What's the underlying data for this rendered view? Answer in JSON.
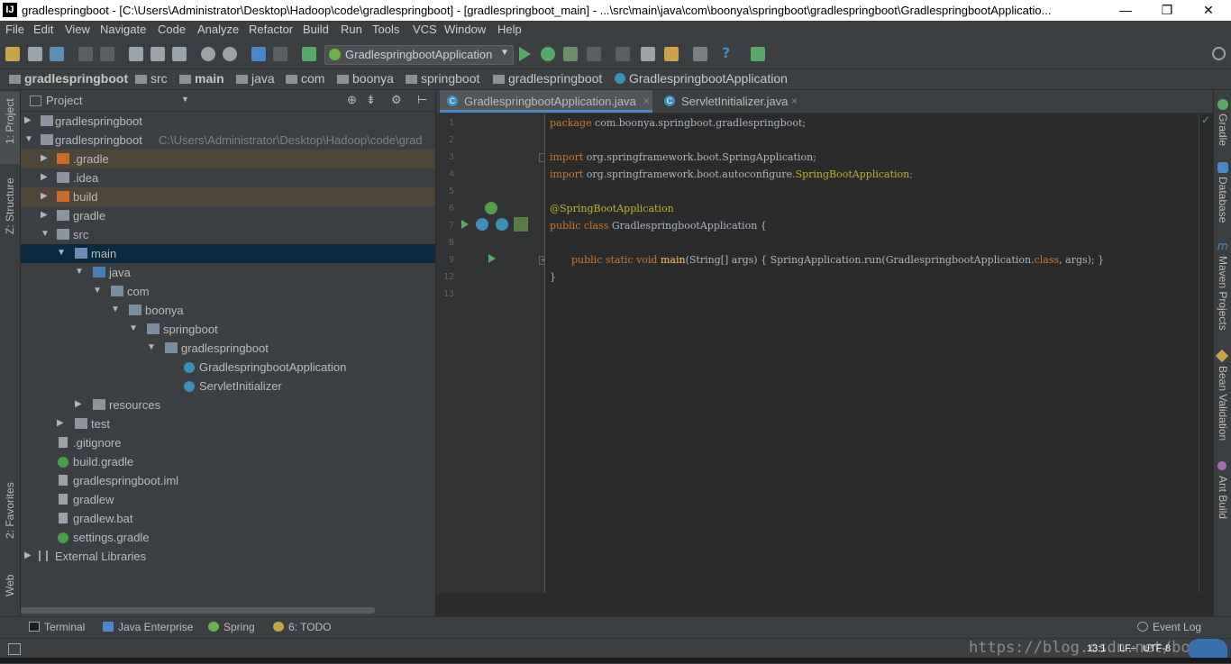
{
  "window": {
    "title": "gradlespringboot - [C:\\Users\\Administrator\\Desktop\\Hadoop\\code\\gradlespringboot] - [gradlespringboot_main] - ...\\src\\main\\java\\com\\boonya\\springboot\\gradlespringboot\\GradlespringbootApplicatio...",
    "minimize": "—",
    "maximize": "❐",
    "close": "✕"
  },
  "menu": [
    "File",
    "Edit",
    "View",
    "Navigate",
    "Code",
    "Analyze",
    "Refactor",
    "Build",
    "Run",
    "Tools",
    "VCS",
    "Window",
    "Help"
  ],
  "toolbar": {
    "run_config": "GradlespringbootApplication",
    "help": "?"
  },
  "breadcrumb": [
    "gradlespringboot",
    "src",
    "main",
    "java",
    "com",
    "boonya",
    "springboot",
    "gradlespringboot",
    "GradlespringbootApplication"
  ],
  "left_stripe": {
    "project": "1: Project",
    "structure": "Z: Structure",
    "favorites": "2: Favorites",
    "web": "Web"
  },
  "project_panel": {
    "title": "Project",
    "tree": [
      {
        "label": "gradlespringboot",
        "arrow": "▶",
        "icon": "module"
      },
      {
        "label": "gradlespringboot",
        "arrow": "▼",
        "icon": "module",
        "path": "C:\\Users\\Administrator\\Desktop\\Hadoop\\code\\grad"
      },
      {
        "label": ".gradle",
        "arrow": "▶",
        "icon": "orange-folder"
      },
      {
        "label": ".idea",
        "arrow": "▶",
        "icon": "folder"
      },
      {
        "label": "build",
        "arrow": "▶",
        "icon": "orange-folder"
      },
      {
        "label": "gradle",
        "arrow": "▶",
        "icon": "folder"
      },
      {
        "label": "src",
        "arrow": "▼",
        "icon": "folder"
      },
      {
        "label": "main",
        "arrow": "▼",
        "icon": "folder"
      },
      {
        "label": "java",
        "arrow": "▼",
        "icon": "folder"
      },
      {
        "label": "com",
        "arrow": "▼",
        "icon": "package"
      },
      {
        "label": "boonya",
        "arrow": "▼",
        "icon": "package"
      },
      {
        "label": "springboot",
        "arrow": "▼",
        "icon": "package"
      },
      {
        "label": "gradlespringboot",
        "arrow": "▼",
        "icon": "package"
      },
      {
        "label": "GradlespringbootApplication",
        "arrow": "",
        "icon": "class"
      },
      {
        "label": "ServletInitializer",
        "arrow": "",
        "icon": "class"
      },
      {
        "label": "resources",
        "arrow": "▶",
        "icon": "folder"
      },
      {
        "label": "test",
        "arrow": "▶",
        "icon": "folder"
      },
      {
        "label": ".gitignore",
        "arrow": "",
        "icon": "file"
      },
      {
        "label": "build.gradle",
        "arrow": "",
        "icon": "gradle"
      },
      {
        "label": "gradlespringboot.iml",
        "arrow": "",
        "icon": "file"
      },
      {
        "label": "gradlew",
        "arrow": "",
        "icon": "file"
      },
      {
        "label": "gradlew.bat",
        "arrow": "",
        "icon": "file"
      },
      {
        "label": "settings.gradle",
        "arrow": "",
        "icon": "gradle"
      },
      {
        "label": "External Libraries",
        "arrow": "▶",
        "icon": "library"
      }
    ]
  },
  "editor": {
    "tabs": [
      {
        "label": "GradlespringbootApplication.java",
        "close": "×"
      },
      {
        "label": "ServletInitializer.java",
        "close": "×"
      }
    ],
    "line_numbers": [
      "1",
      "2",
      "3",
      "4",
      "5",
      "6",
      "7",
      "8",
      "9",
      "12",
      "13"
    ],
    "code": {
      "l1_kw": "package",
      "l1_rest": " com.boonya.springboot.gradlespringboot;",
      "l3_kw": "import",
      "l3_rest": " org.springframework.boot.SpringApplication;",
      "l4_kw": "import",
      "l4_rest": " org.springframework.boot.autoconfigure.",
      "l4_ann": "SpringBootApplication",
      "l4_end": ";",
      "l6_ann": "@SpringBootApplication",
      "l7_kw": "public class",
      "l7_rest": " GradlespringbootApplication {",
      "l9_kw": "public static void",
      "l9_fn": " main",
      "l9_rest": "(String[] args) { SpringApplication.run(GradlespringbootApplication.",
      "l9_kw2": "class",
      "l9_end": ", args); }",
      "l12": "}"
    }
  },
  "right_stripe": [
    "Gradle",
    "Database",
    "Maven Projects",
    "Bean Validation",
    "Ant Build"
  ],
  "bottom_tools": [
    "Terminal",
    "Java Enterprise",
    "Spring",
    "6: TODO"
  ],
  "event_log": "Event Log",
  "status": {
    "position": "13:1",
    "line_sep": "LF÷",
    "encoding": "UTF-8",
    "watermark": "https://blog.csdn.net/boonya"
  }
}
